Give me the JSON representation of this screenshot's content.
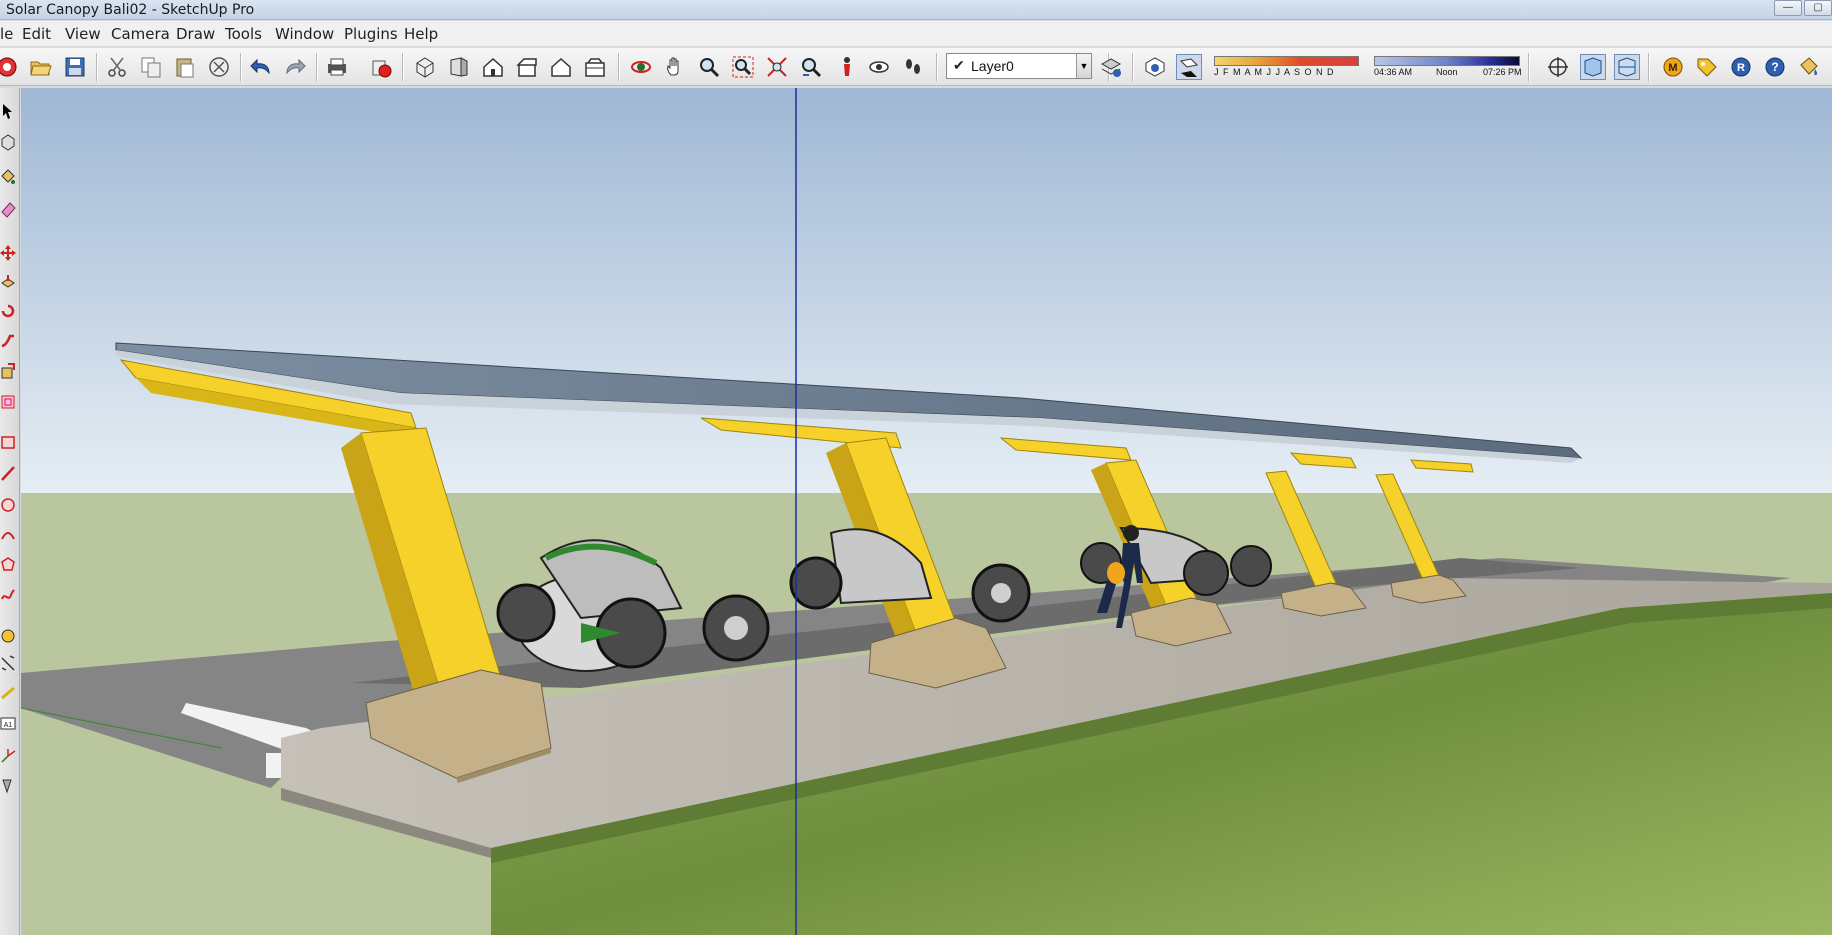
{
  "window": {
    "title": "Solar Canopy Bali02 - SketchUp Pro",
    "minimize_label": "—",
    "maximize_label": "▢"
  },
  "menu": {
    "items": [
      "le",
      "Edit",
      "View",
      "Camera",
      "Draw",
      "Tools",
      "Window",
      "Plugins",
      "Help"
    ]
  },
  "toolbar": {
    "layer": {
      "check": "✔",
      "name": "Layer0"
    },
    "shadow_months": "J F M A M J J A S O N D",
    "shadow_times": [
      "04:36 AM",
      "Noon",
      "07:26 PM"
    ],
    "icons": [
      "get-models-icon",
      "open-icon",
      "save-icon",
      "cut-icon",
      "copy-icon",
      "paste-icon",
      "erase-icon",
      "undo-icon",
      "redo-icon",
      "print-icon",
      "model-info-icon",
      "iso-view-icon",
      "top-view-icon",
      "front-view-icon",
      "right-view-icon",
      "back-view-icon",
      "left-view-icon",
      "orbit-icon",
      "pan-icon",
      "zoom-icon",
      "zoom-window-icon",
      "zoom-extents-icon",
      "previous-view-icon",
      "position-camera-icon",
      "look-around-icon",
      "walk-icon",
      "layer-manager-icon",
      "shadows-settings-icon",
      "display-shadows-icon",
      "section-plane-icon",
      "display-section-planes-icon",
      "display-section-cuts-icon",
      "m-plugin-icon",
      "tag-plugin-icon",
      "r-plugin-icon",
      "help-icon",
      "paint-bucket-plugin-icon"
    ]
  },
  "left_tools": [
    "select-icon",
    "make-component-icon",
    "paint-bucket-icon",
    "eraser-icon",
    "move-icon",
    "push-pull-icon",
    "rotate-icon",
    "follow-me-icon",
    "scale-icon",
    "offset-icon",
    "rectangle-icon",
    "line-icon",
    "circle-icon",
    "arc-icon",
    "polygon-icon",
    "freehand-icon",
    "tape-measure-icon",
    "dimension-icon",
    "protractor-icon",
    "text-icon",
    "axes-icon",
    "3d-text-icon"
  ],
  "colors": {
    "canopy_yellow": "#f5d12a",
    "canopy_shadow": "#c9a416",
    "ground_green": "#b7c49c",
    "grass": "#7d9d45",
    "sky_top": "#9fb7d4",
    "sky_bottom": "#e6eef4",
    "blue_axis": "#1a2f9a"
  }
}
